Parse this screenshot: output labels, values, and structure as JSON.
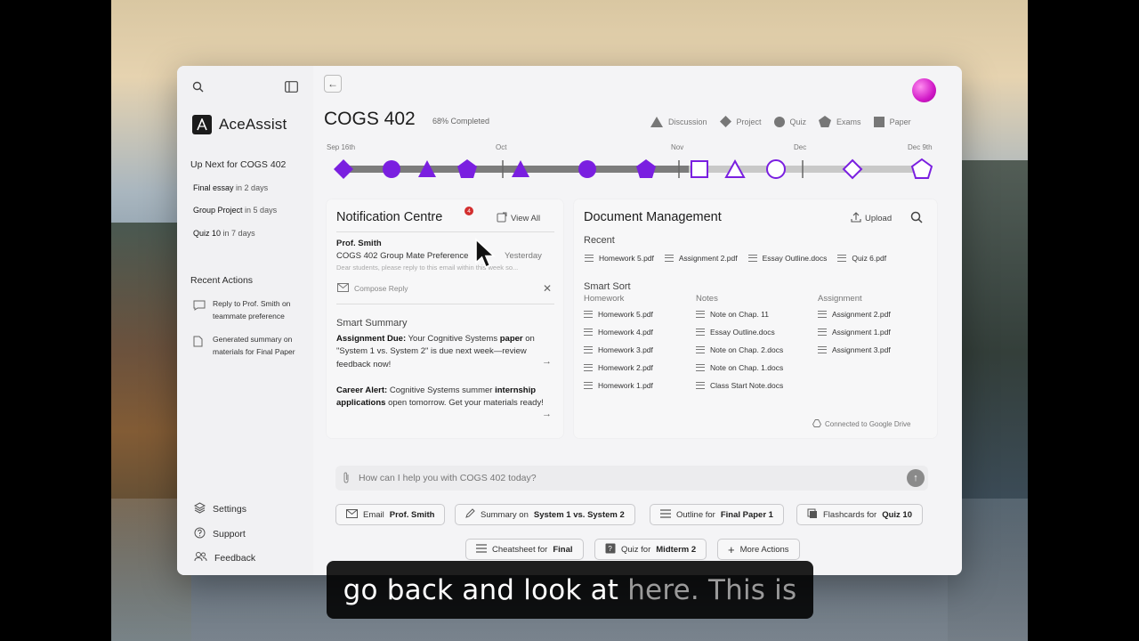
{
  "sidebar": {
    "brand": "AceAssist",
    "up_next_heading": "Up Next for COGS 402",
    "up_next": [
      {
        "name": "Final essay",
        "due": "in 2 days"
      },
      {
        "name": "Group Project",
        "due": "in 5 days"
      },
      {
        "name": "Quiz 10",
        "due": "in 7 days"
      }
    ],
    "recent_heading": "Recent Actions",
    "recent": [
      {
        "pre": "Reply to ",
        "bold": "Prof. Smith",
        "post": " on teammate preference"
      },
      {
        "pre": "Generated summary on materials for ",
        "bold": "Final Paper",
        "post": ""
      }
    ],
    "bottom": {
      "settings": "Settings",
      "support": "Support",
      "feedback": "Feedback"
    }
  },
  "header": {
    "course": "COGS 402",
    "progress": "68% Completed",
    "legend": [
      "Discussion",
      "Project",
      "Quiz",
      "Exams",
      "Paper"
    ]
  },
  "timeline": {
    "labels": [
      "Sep 16th",
      "Oct",
      "Nov",
      "Dec",
      "Dec 9th"
    ]
  },
  "notifications": {
    "title": "Notification Centre",
    "badge": "4",
    "view_all": "View All",
    "from": "Prof. Smith",
    "subject": "COGS 402 Group Mate Preference",
    "time": "Yesterday",
    "preview": "Dear students, please reply to this email within this week so...",
    "compose": "Compose Reply",
    "summary_title": "Smart Summary",
    "summary1": {
      "label": "Assignment Due:",
      "text1": " Your Cognitive Systems ",
      "bold": "paper",
      "text2": " on \"System 1 vs. System 2\" is due next week—review feedback now!"
    },
    "summary2": {
      "label": "Career Alert:",
      "text1": " Cognitive Systems summer ",
      "bold": "internship applications",
      "text2": " open tomorrow. Get your materials ready!"
    }
  },
  "documents": {
    "title": "Document Management",
    "upload": "Upload",
    "recent_label": "Recent",
    "recent": [
      "Homework 5.pdf",
      "Assignment 2.pdf",
      "Essay Outline.docs",
      "Quiz 6.pdf"
    ],
    "smart_sort_label": "Smart Sort",
    "homework_label": "Homework",
    "homework": [
      "Homework 5.pdf",
      "Homework 4.pdf",
      "Homework 3.pdf",
      "Homework 2.pdf",
      "Homework 1.pdf"
    ],
    "notes_label": "Notes",
    "notes": [
      "Note on Chap. 11",
      "Essay Outline.docs",
      "Note on Chap. 2.docs",
      "Note on Chap. 1.docs",
      "Class Start Note.docs"
    ],
    "assignment_label": "Assignment",
    "assignment": [
      "Assignment 2.pdf",
      "Assignment 1.pdf",
      "Assignment 3.pdf"
    ],
    "drive": "Connected to Google Drive"
  },
  "chat": {
    "placeholder": "How can I help you with COGS 402 today?"
  },
  "actions": {
    "email_pre": "Email ",
    "email_bold": "Prof. Smith",
    "summary_pre": "Summary on ",
    "summary_bold": "System 1 vs. System 2",
    "outline_pre": "Outline for ",
    "outline_bold": "Final Paper 1",
    "flash_pre": "Flashcards for ",
    "flash_bold": "Quiz 10",
    "cheat_pre": "Cheatsheet for ",
    "cheat_bold": "Final",
    "quiz_pre": "Quiz for ",
    "quiz_bold": "Midterm 2",
    "more": "More Actions"
  },
  "caption": {
    "spoken": "go back and look at",
    "upcoming": " here. This is"
  },
  "colors": {
    "accent": "#7a1fe0",
    "avatar": "#d11ac7",
    "badge": "#d32f2f"
  }
}
